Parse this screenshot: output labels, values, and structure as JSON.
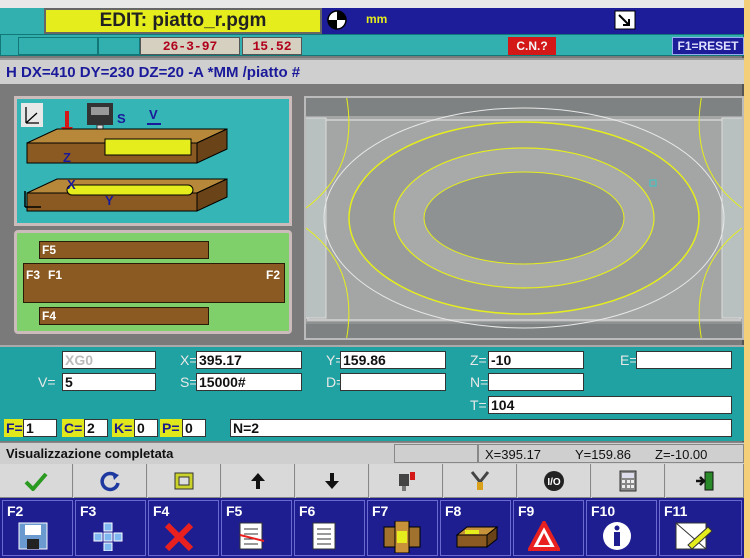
{
  "window": {
    "title": "EDIT: piatto_r.pgm",
    "unit_label": "mm"
  },
  "infobar": {
    "date": "26-3-97",
    "time": "15.52",
    "cn_label": "C.N.?",
    "reset_label": "F1=RESET"
  },
  "command_line": "H DX=410 DY=230 DZ=20 -A *MM /piatto #",
  "diagram": {
    "z_label": "Z",
    "x_label": "X",
    "y_label": "Y",
    "s_label": "S",
    "v_label": "V"
  },
  "faces": {
    "f5": "F5",
    "f1": "F1",
    "f2": "F2",
    "f3": "F3",
    "f4": "F4"
  },
  "coords": {
    "xg_field": "XG0",
    "x_label": "X=",
    "x_value": "395.17",
    "y_label": "Y=",
    "y_value": "159.86",
    "z_label": "Z=",
    "z_value": "-10",
    "e_label": "E=",
    "e_value": "",
    "v_label": "V=",
    "v_value": "5",
    "s_label": "S=",
    "s_value": "15000#",
    "d_label": "D=",
    "d_value": "",
    "n_label": "N=",
    "n_value": "",
    "t_label": "T=",
    "t_value": "104",
    "f_label": "F=",
    "f_value": "1",
    "c_label": "C=",
    "c_value": "2",
    "k_label": "K=",
    "k_value": "0",
    "p_label": "P=",
    "p_value": "0",
    "n2_value": "N=2"
  },
  "status": {
    "message": "Visualizzazione completata",
    "x": "X=395.17",
    "y": "Y=159.86",
    "z": "Z=-10.00"
  },
  "toolbar_top": [
    {
      "icon": "check-icon"
    },
    {
      "icon": "refresh-icon"
    },
    {
      "icon": "window-icon"
    },
    {
      "icon": "arrow-up-icon"
    },
    {
      "icon": "arrow-down-icon"
    },
    {
      "icon": "tool-change-icon"
    },
    {
      "icon": "tool-icon"
    },
    {
      "icon": "io-icon"
    },
    {
      "icon": "calculator-icon"
    },
    {
      "icon": "exit-icon"
    }
  ],
  "function_keys": [
    {
      "label": "F2",
      "icon": "save-icon"
    },
    {
      "label": "F3",
      "icon": "move-icon"
    },
    {
      "label": "F4",
      "icon": "delete-icon"
    },
    {
      "label": "F5",
      "icon": "list-edit-icon"
    },
    {
      "label": "F6",
      "icon": "list-icon"
    },
    {
      "label": "F7",
      "icon": "faces-icon"
    },
    {
      "label": "F8",
      "icon": "piece-icon"
    },
    {
      "label": "F9",
      "icon": "warning-icon"
    },
    {
      "label": "F10",
      "icon": "info-icon"
    },
    {
      "label": "F11",
      "icon": "edit-drawing-icon"
    }
  ],
  "colors": {
    "accent_yellow": "#e5ee1c",
    "teal": "#21a2a2",
    "navy": "#1e1e90",
    "red": "#d41818"
  }
}
